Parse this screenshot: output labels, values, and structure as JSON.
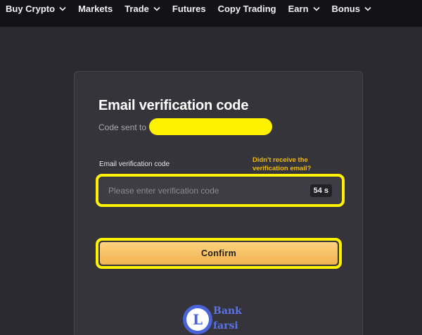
{
  "nav": {
    "items": [
      {
        "label": "Buy Crypto",
        "dropdown": true
      },
      {
        "label": "Markets",
        "dropdown": false
      },
      {
        "label": "Trade",
        "dropdown": true
      },
      {
        "label": "Futures",
        "dropdown": false
      },
      {
        "label": "Copy Trading",
        "dropdown": false
      },
      {
        "label": "Earn",
        "dropdown": true
      },
      {
        "label": "Bonus",
        "dropdown": true
      }
    ]
  },
  "verify": {
    "title": "Email verification code",
    "sent_prefix": "Code sent to",
    "field_label": "Email verification code",
    "resend_text": "Didn't receive the verification email?",
    "placeholder": "Please enter verification code",
    "countdown": "54 s",
    "confirm_label": "Confirm"
  },
  "colors": {
    "highlight": "#fff200",
    "accent": "#f0b90b",
    "button": "#f7c56a"
  },
  "watermark": {
    "letter": "L",
    "line1": "Bank",
    "line2": "farsi"
  }
}
